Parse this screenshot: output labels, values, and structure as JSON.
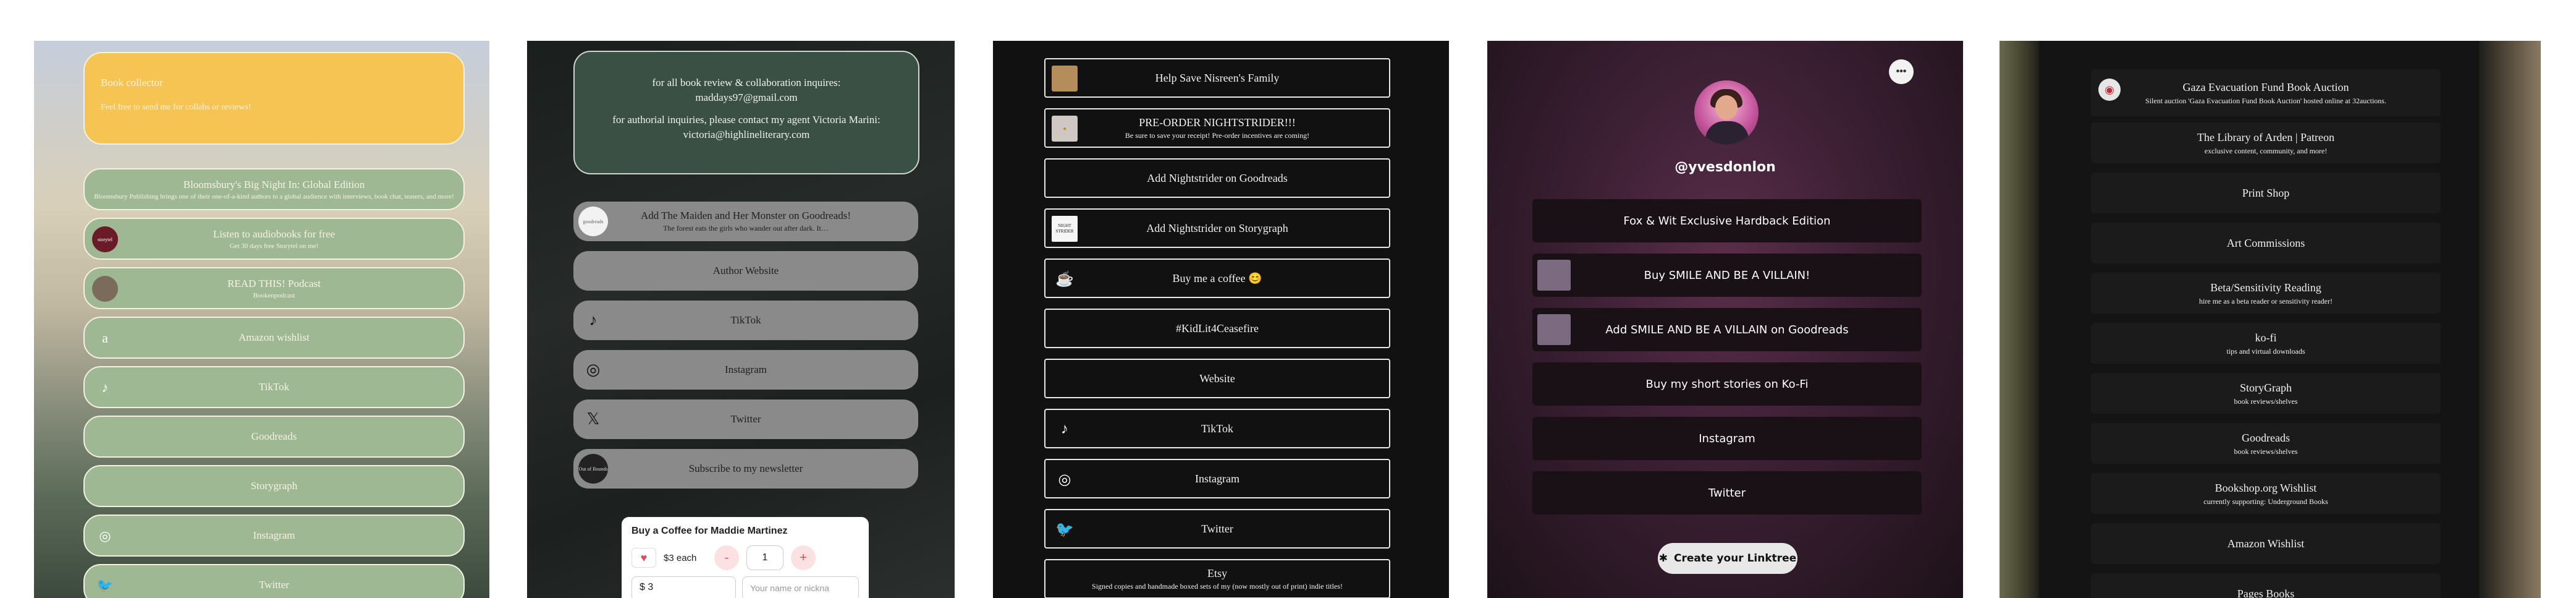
{
  "panel1": {
    "hero": {
      "title": "Book collector",
      "subtitle": "Feel free to send me for collabs or reviews!"
    },
    "buttons": [
      {
        "label": "Bloomsbury's Big Night In: Global Edition",
        "desc": "Bloomsbury Publishing brings one of their one-of-a-kind authors to a global audience with interviews, book chat, teasers, and more!"
      },
      {
        "label": "Listen to audiobooks for free",
        "desc": "Get 30 days free Storytel on me!",
        "icon": "storytel-logo-icon",
        "icon_text": "storytel"
      },
      {
        "label": "READ THIS! Podcast",
        "desc": "Bookenpodcast",
        "icon": "podcast-cover-icon"
      },
      {
        "label": "Amazon wishlist",
        "icon": "amazon-icon",
        "glyph": "a"
      },
      {
        "label": "TikTok",
        "icon": "tiktok-icon",
        "glyph": "♪"
      },
      {
        "label": "Goodreads"
      },
      {
        "label": "Storygraph"
      },
      {
        "label": "Instagram",
        "icon": "instagram-icon",
        "glyph": "◎"
      },
      {
        "label": "Twitter",
        "icon": "twitter-icon",
        "glyph": "🐦"
      }
    ]
  },
  "panel2": {
    "info": {
      "line1": "for all book review & collaboration inquires:",
      "line2": "maddays97@gmail.com",
      "line3": "for authorial inquiries, please contact my agent Victoria Marini:",
      "line4": "victoria@highlineliterary.com"
    },
    "buttons": [
      {
        "label": "Add The Maiden and Her Monster on Goodreads!",
        "desc": "The forest eats the girls who wander out after dark. It…",
        "icon": "goodreads-logo-icon",
        "icon_text": "goodreads"
      },
      {
        "label": "Author Website"
      },
      {
        "label": "TikTok",
        "icon": "tiktok-icon",
        "glyph": "♪"
      },
      {
        "label": "Instagram",
        "icon": "instagram-icon",
        "glyph": "◎"
      },
      {
        "label": "Twitter",
        "icon": "x-icon",
        "glyph": "𝕏"
      },
      {
        "label": "Subscribe to my newsletter",
        "icon": "newsletter-icon",
        "icon_text": "Out of Bounds"
      }
    ],
    "coffee": {
      "title": "Buy a Coffee for Maddie Martinez",
      "each": "$3 each",
      "minus": "-",
      "qty": "1",
      "plus": "+",
      "amount": "$  3",
      "name_placeholder": "Your name or nickna"
    }
  },
  "panel3": {
    "buttons": [
      {
        "label": "Help Save Nisreen's Family",
        "icon": "family-photo-icon"
      },
      {
        "label": "PRE-ORDER NIGHTSTRIDER!!!",
        "desc": "Be sure to save your receipt! Pre-order incentives are coming!",
        "icon": "preorder-thumb-icon"
      },
      {
        "label": "Add Nightstrider on Goodreads"
      },
      {
        "label": "Add Nightstrider on Storygraph",
        "icon": "book-cover-icon",
        "icon_text": "NIGHT STRIDER"
      },
      {
        "label": "Buy me a coffee 😊",
        "icon": "coffee-cup-icon",
        "glyph": "☕"
      },
      {
        "label": "#KidLit4Ceasefire"
      },
      {
        "label": "Website"
      },
      {
        "label": "TikTok",
        "icon": "tiktok-icon",
        "glyph": "♪"
      },
      {
        "label": "Instagram",
        "icon": "instagram-icon",
        "glyph": "◎"
      },
      {
        "label": "Twitter",
        "icon": "twitter-icon",
        "glyph": "🐦"
      },
      {
        "label": "Etsy",
        "desc": "Signed copies and handmade boxed sets of my (now mostly out of print) indie titles!"
      }
    ]
  },
  "panel4": {
    "more": "•••",
    "handle": "@yvesdonlon",
    "buttons": [
      {
        "label": "Fox & Wit Exclusive Hardback Edition"
      },
      {
        "label": "Buy SMILE AND BE A VILLAIN!",
        "icon": "book-cover-icon"
      },
      {
        "label": "Add SMILE AND BE A VILLAIN on Goodreads",
        "icon": "book-cover-icon"
      },
      {
        "label": "Buy my short stories on Ko-Fi"
      },
      {
        "label": "Instagram"
      },
      {
        "label": "Twitter"
      }
    ],
    "cta": "Create your Linktree",
    "cta_glyph": "✱"
  },
  "panel5": {
    "buttons": [
      {
        "label": "Gaza Evacuation Fund Book Auction",
        "desc": "Silent auction 'Gaza Evacuation Fund Book Auction' hosted online at 32auctions.",
        "icon": "auction-logo-icon"
      },
      {
        "label": "The Library of Arden | Patreon",
        "desc": "exclusive content, community, and more!"
      },
      {
        "label": "Print Shop"
      },
      {
        "label": "Art Commissions"
      },
      {
        "label": "Beta/Sensitivity Reading",
        "desc": "hire me as a beta reader or sensitivity reader!"
      },
      {
        "label": "ko-fi",
        "desc": "tips and virtual downloads"
      },
      {
        "label": "StoryGraph",
        "desc": "book reviews/shelves"
      },
      {
        "label": "Goodreads",
        "desc": "book reviews/shelves"
      },
      {
        "label": "Bookshop.org Wishlist",
        "desc": "currently supporting: Underground Books"
      },
      {
        "label": "Amazon Wishlist"
      },
      {
        "label": "Pages Books"
      }
    ]
  }
}
